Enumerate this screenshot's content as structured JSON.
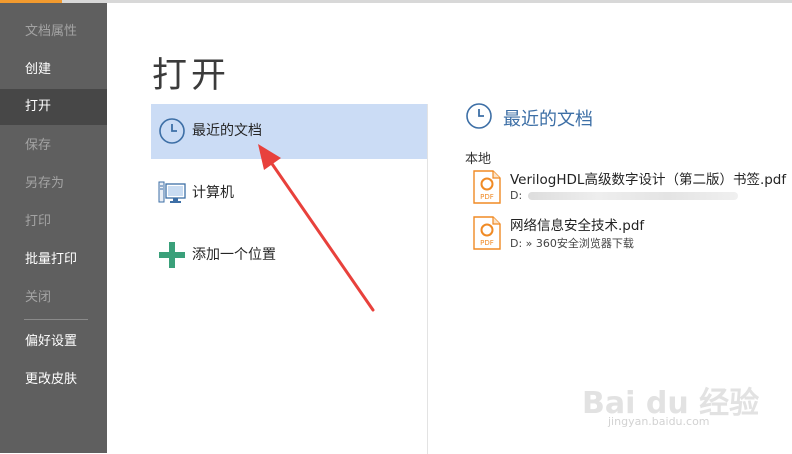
{
  "sidebar": {
    "items": [
      {
        "label": "文档属性"
      },
      {
        "label": "创建"
      },
      {
        "label": "打开"
      },
      {
        "label": "保存"
      },
      {
        "label": "另存为"
      },
      {
        "label": "打印"
      },
      {
        "label": "批量打印"
      },
      {
        "label": "关闭"
      },
      {
        "label": "偏好设置"
      },
      {
        "label": "更改皮肤"
      }
    ]
  },
  "main": {
    "title": "打开",
    "places": [
      {
        "label": "最近的文档",
        "icon": "clock-icon"
      },
      {
        "label": "计算机",
        "icon": "computer-icon"
      },
      {
        "label": "添加一个位置",
        "icon": "plus-icon"
      }
    ],
    "recent": {
      "heading": "最近的文档",
      "group_label": "本地",
      "files": [
        {
          "name": "VerilogHDL高级数字设计（第二版）书签.pdf",
          "path": "D:",
          "icon": "pdf-icon"
        },
        {
          "name": "网络信息安全技术.pdf",
          "path": "D: » 360安全浏览器下载",
          "icon": "pdf-icon"
        }
      ]
    }
  },
  "watermark": {
    "brand": "Bai du 经验",
    "url": "jingyan.baidu.com"
  },
  "colors": {
    "sidebar_bg": "#5f5f5f",
    "sidebar_active": "#474747",
    "selected_place": "#cbdcf5",
    "accent_blue": "#3d6fa6",
    "pdf_orange": "#f08a24",
    "arrow_red": "#e8413c"
  }
}
